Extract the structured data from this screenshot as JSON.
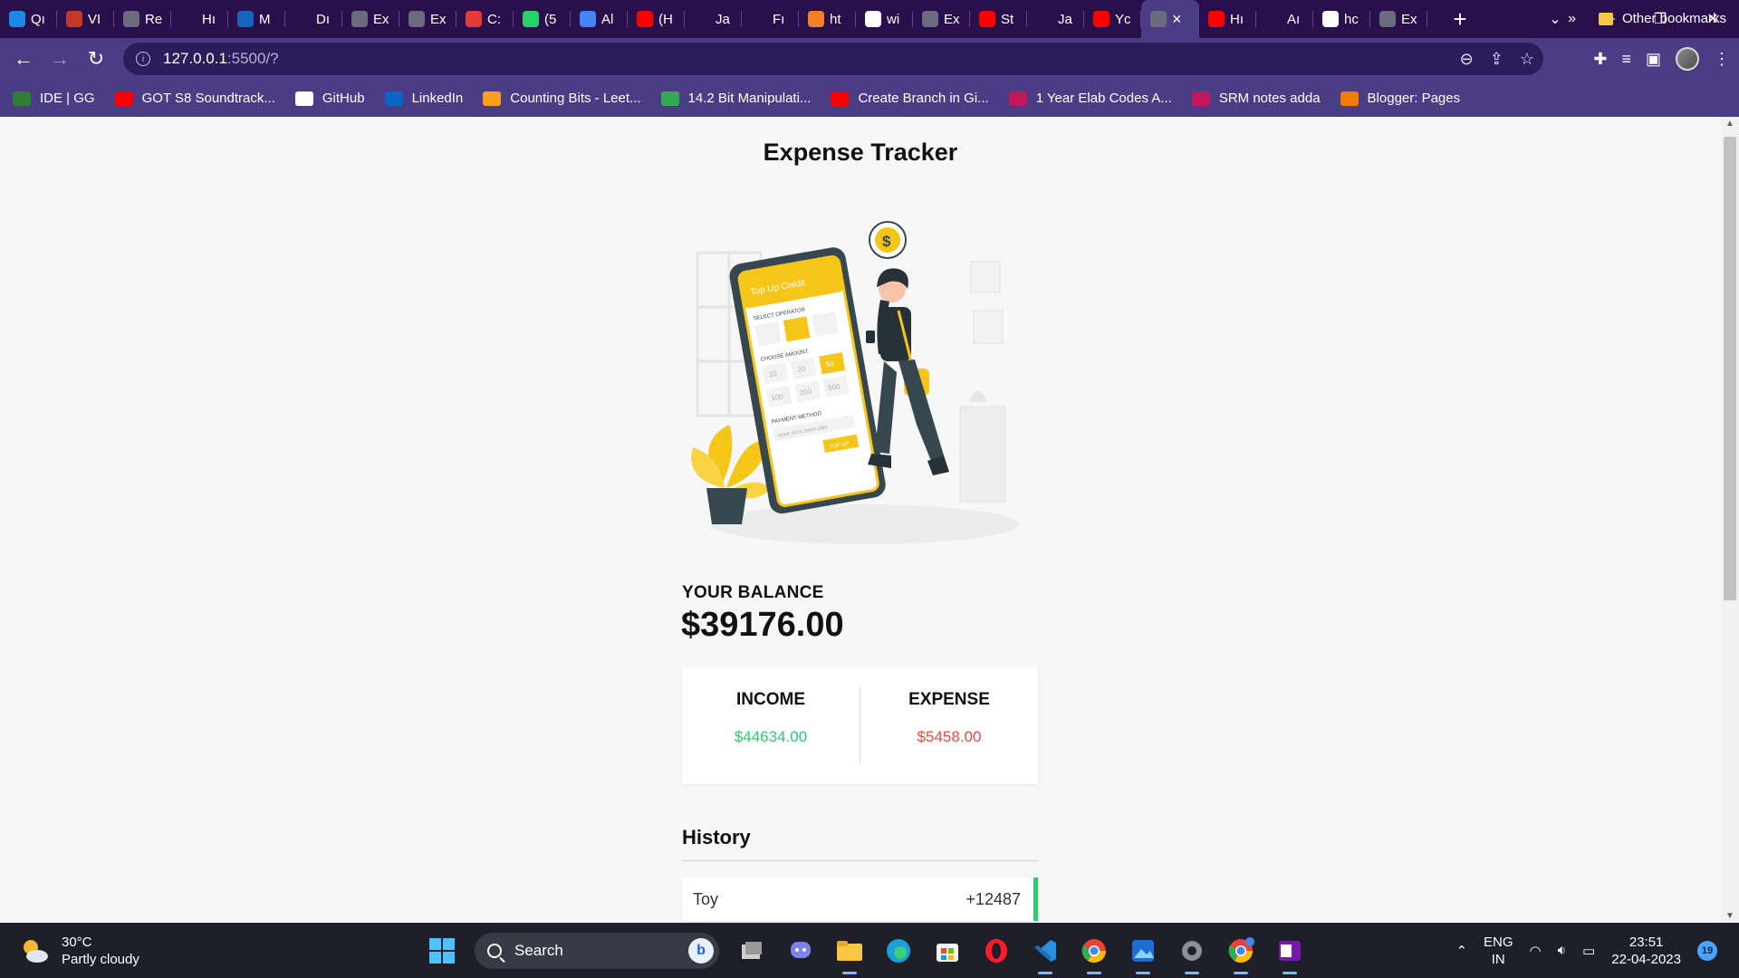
{
  "browser": {
    "tabs": [
      {
        "short": "Qı",
        "icon": "q-icon",
        "color": "#1e88e5"
      },
      {
        "short": "VI",
        "icon": "shield-icon",
        "color": "#c0392b"
      },
      {
        "short": "Re",
        "icon": "globe-icon",
        "color": "#6b6b80"
      },
      {
        "short": "Hı",
        "icon": "code-icon",
        "color": "#2a0f4d"
      },
      {
        "short": "M",
        "icon": "m-icon",
        "color": "#1565c0"
      },
      {
        "short": "Dı",
        "icon": "download-icon",
        "color": "#2a0f4d"
      },
      {
        "short": "Ex",
        "icon": "globe-icon",
        "color": "#6b6b80"
      },
      {
        "short": "Ex",
        "icon": "globe-icon",
        "color": "#6b6b80"
      },
      {
        "short": "C:",
        "icon": "fire-icon",
        "color": "#e53935"
      },
      {
        "short": "(5",
        "icon": "whatsapp-icon",
        "color": "#25d366"
      },
      {
        "short": "Al",
        "icon": "docs-icon",
        "color": "#4285f4"
      },
      {
        "short": "(H",
        "icon": "youtube-icon",
        "color": "#ff0000"
      },
      {
        "short": "Ja",
        "icon": "github-icon",
        "color": "#2a0f4d"
      },
      {
        "short": "Fı",
        "icon": "m-icon",
        "color": "#2a0f4d"
      },
      {
        "short": "ht",
        "icon": "stack-icon",
        "color": "#f48024"
      },
      {
        "short": "wi",
        "icon": "google-icon",
        "color": "#ffffff"
      },
      {
        "short": "Ex",
        "icon": "globe-icon",
        "color": "#6b6b80"
      },
      {
        "short": "St",
        "icon": "youtube-icon",
        "color": "#ff0000"
      },
      {
        "short": "Ja",
        "icon": "w-icon",
        "color": "#2a0f4d"
      },
      {
        "short": "Yc",
        "icon": "youtube-music-icon",
        "color": "#ff0000"
      },
      {
        "short": "×",
        "icon": "globe-icon",
        "color": "#6b6b80",
        "active": true
      },
      {
        "short": "Hı",
        "icon": "youtube-icon",
        "color": "#ff0000"
      },
      {
        "short": "Aı",
        "icon": "m-icon",
        "color": "#2a0f4d"
      },
      {
        "short": "hc",
        "icon": "google-icon",
        "color": "#ffffff"
      },
      {
        "short": "Ex",
        "icon": "globe-icon",
        "color": "#6b6b80"
      }
    ],
    "new_tab": "+",
    "address": {
      "host": "127.0.0.1",
      "path": ":5500/?"
    },
    "bookmarks": [
      {
        "label": "IDE | GG",
        "color": "#2e7d32"
      },
      {
        "label": "GOT S8 Soundtrack...",
        "color": "#ff0000"
      },
      {
        "label": "GitHub",
        "color": "#ffffff"
      },
      {
        "label": "LinkedIn",
        "color": "#0a66c2"
      },
      {
        "label": "Counting Bits - Leet...",
        "color": "#f89f1b"
      },
      {
        "label": "14.2 Bit Manipulati...",
        "color": "#34a853"
      },
      {
        "label": "Create Branch in Gi...",
        "color": "#ff0000"
      },
      {
        "label": "1 Year Elab Codes A...",
        "color": "#c2185b"
      },
      {
        "label": "SRM notes adda",
        "color": "#c2185b"
      },
      {
        "label": "Blogger: Pages",
        "color": "#f57c00"
      }
    ],
    "bookmarks_more": "»",
    "other_bookmarks": "Other bookmarks"
  },
  "page": {
    "title": "Expense Tracker",
    "illustration": {
      "screen_heading": "Top Up Credit",
      "select_operator": "SELECT OPERATOR",
      "choose_amount": "CHOOSE AMOUNT",
      "amounts": [
        "10",
        "20",
        "50",
        "100",
        "200",
        "500"
      ],
      "payment_method": "PAYMENT METHOD",
      "card_number": "XXXX XXXX XXXX 2480",
      "top_up": "TOP UP",
      "coin_symbol": "$"
    },
    "balance_label": "YOUR BALANCE",
    "balance_value": "$39176.00",
    "income_label": "INCOME",
    "income_value": "$44634.00",
    "expense_label": "EXPENSE",
    "expense_value": "$5458.00",
    "history_title": "History",
    "history": [
      {
        "name": "Toy",
        "amount": "+12487"
      }
    ],
    "colors": {
      "income": "#2ecc71",
      "expense": "#e74c3c",
      "accent": "#f5c518"
    }
  },
  "taskbar": {
    "weather_temp": "30°C",
    "weather_desc": "Partly cloudy",
    "search_placeholder": "Search",
    "lang_line1": "ENG",
    "lang_line2": "IN",
    "time": "23:51",
    "date": "22-04-2023",
    "notification_count": "19",
    "apps": [
      "task-view-icon",
      "teams-icon",
      "file-explorer-icon",
      "edge-icon",
      "store-icon",
      "opera-icon",
      "vscode-icon",
      "chrome-icon",
      "photos-icon",
      "settings-icon",
      "chrome-profile-icon",
      "onenote-icon"
    ]
  }
}
